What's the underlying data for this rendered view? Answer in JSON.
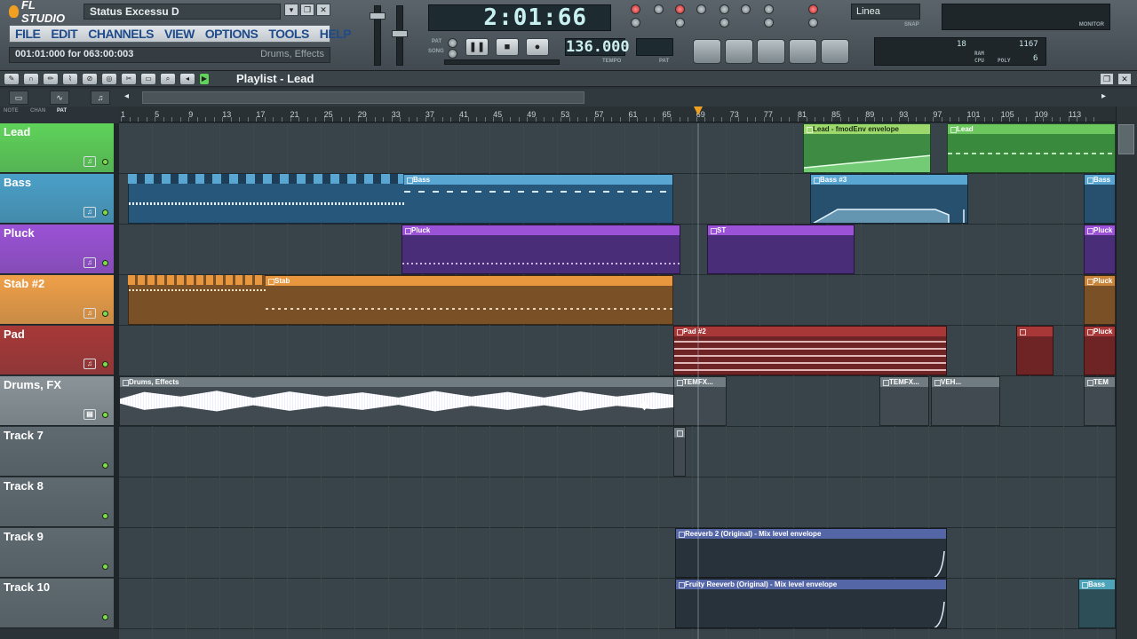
{
  "app": {
    "logo": "FL STUDIO",
    "song_title": "Status Excessu D"
  },
  "menu": [
    "FILE",
    "EDIT",
    "CHANNELS",
    "VIEW",
    "OPTIONS",
    "TOOLS",
    "HELP"
  ],
  "hint": {
    "time": "001:01:000 for 063:00:003",
    "name": "Drums, Effects"
  },
  "transport": {
    "song_time": "2:01:66",
    "tempo": "136.000",
    "tempo_label": "TEMPO",
    "pat_label": "PAT",
    "song_label": "SONG",
    "pat_value": "PAT"
  },
  "snap": {
    "value": "Linea",
    "label": "SNAP"
  },
  "cpu": {
    "value1": "18",
    "value2": "1167",
    "ram_label": "RAM",
    "cpu_label": "CPU",
    "poly_label": "POLY",
    "poly_value": "6",
    "monitor_label": "MONITOR"
  },
  "playlist": {
    "title": "Playlist - Lead",
    "modes": [
      "NOTE",
      "CHAN",
      "PAT"
    ]
  },
  "ruler": [
    "1",
    "5",
    "9",
    "13",
    "17",
    "21",
    "25",
    "29",
    "33",
    "37",
    "41",
    "45",
    "49",
    "53",
    "57",
    "61",
    "65",
    "69",
    "73",
    "77",
    "81",
    "85",
    "89",
    "93",
    "97",
    "101",
    "105",
    "109",
    "113"
  ],
  "tracks": [
    {
      "name": "Lead",
      "color": "#5fd35a"
    },
    {
      "name": "Bass",
      "color": "#4aa0c8"
    },
    {
      "name": "Pluck",
      "color": "#9b52d6"
    },
    {
      "name": "Stab #2",
      "color": "#f0a048"
    },
    {
      "name": "Pad",
      "color": "#a83838"
    },
    {
      "name": "Drums, FX",
      "color": "#8a9499"
    },
    {
      "name": "Track 7",
      "color": "#5f6a70"
    },
    {
      "name": "Track 8",
      "color": "#5f6a70"
    },
    {
      "name": "Track 9",
      "color": "#5f6a70"
    },
    {
      "name": "Track 10",
      "color": "#5f6a70"
    }
  ],
  "clips": {
    "lead_env": "Lead - fmodEnv envelope",
    "lead2": "Lead",
    "bass": "Bass",
    "bass3": "Bass #3",
    "pluck": "Pluck",
    "st": "ST",
    "stab": "Stab",
    "pad2": "Pad #2",
    "pluck_r": "Pluck",
    "drums": "Drums, Effects",
    "temfx": "TEMFX...",
    "temfx2": "TEMFX...",
    "veh": "VEH...",
    "tem": "TEM",
    "reverb": "Reeverb 2 (Original) - Mix level envelope",
    "fruity": "Fruity Reeverb (Original) - Mix level envelope",
    "bass_r": "Bass"
  }
}
